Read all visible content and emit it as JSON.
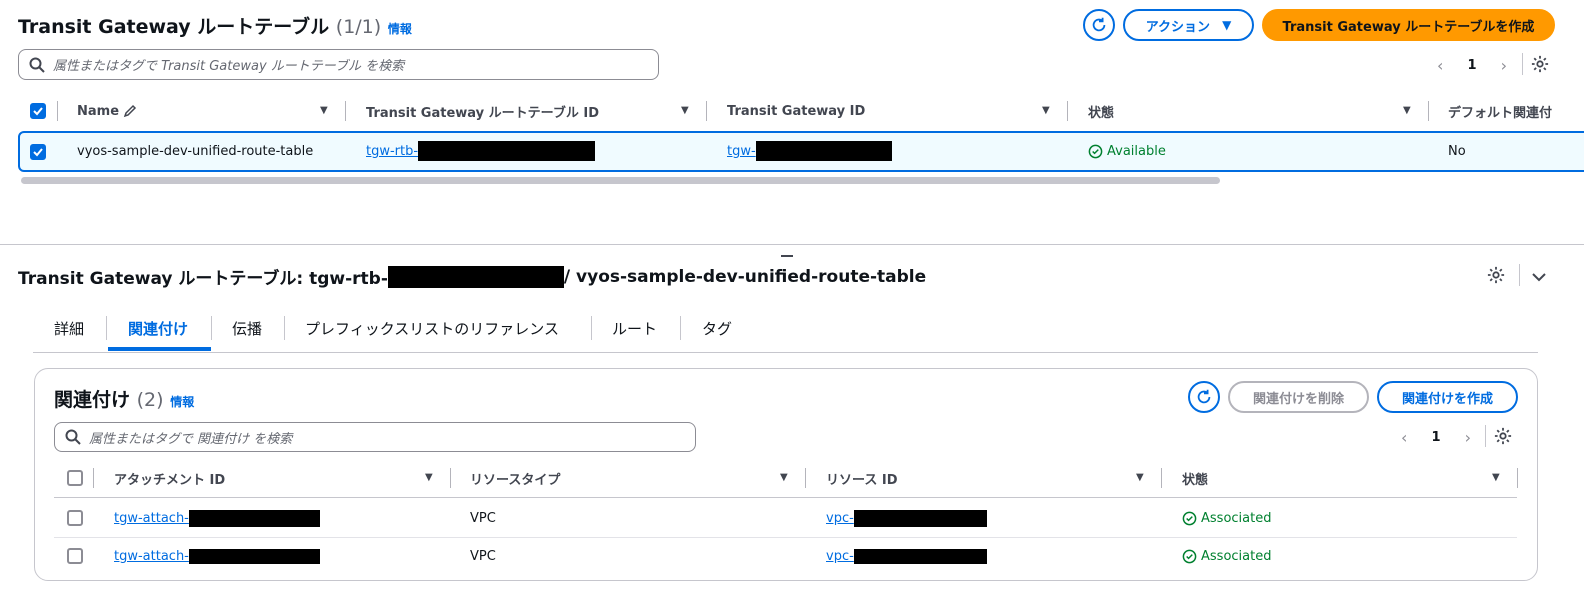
{
  "top": {
    "title": "Transit Gateway ルートテーブル",
    "count": "(1/1)",
    "info": "情報",
    "actions_label": "アクション",
    "create_label": "Transit Gateway ルートテーブルを作成",
    "search_placeholder": "属性またはタグで Transit Gateway ルートテーブル を検索",
    "page": "1",
    "columns": [
      "Name",
      "Transit Gateway ルートテーブル ID",
      "Transit Gateway ID",
      "状態",
      "デフォルト関連付"
    ],
    "row": {
      "name": "vyos-sample-dev-unified-route-table",
      "rtb_id": "tgw-rtb-",
      "tgw_id": "tgw-",
      "status": "Available",
      "default": "No"
    }
  },
  "detail": {
    "title_prefix": "Transit Gateway ルートテーブル: tgw-rtb-",
    "title_suffix": "/ vyos-sample-dev-unified-route-table",
    "tabs": [
      "詳細",
      "関連付け",
      "伝播",
      "プレフィックスリストのリファレンス",
      "ルート",
      "タグ"
    ]
  },
  "assoc": {
    "title": "関連付け",
    "count": "(2)",
    "info": "情報",
    "delete_label": "関連付けを削除",
    "create_label": "関連付けを作成",
    "search_placeholder": "属性またはタグで 関連付け を検索",
    "page": "1",
    "columns": [
      "アタッチメント ID",
      "リソースタイプ",
      "リソース ID",
      "状態"
    ],
    "rows": [
      {
        "attach": "tgw-attach-",
        "type": "VPC",
        "res": "vpc-",
        "status": "Associated"
      },
      {
        "attach": "tgw-attach-",
        "type": "VPC",
        "res": "vpc-",
        "status": "Associated"
      }
    ]
  }
}
